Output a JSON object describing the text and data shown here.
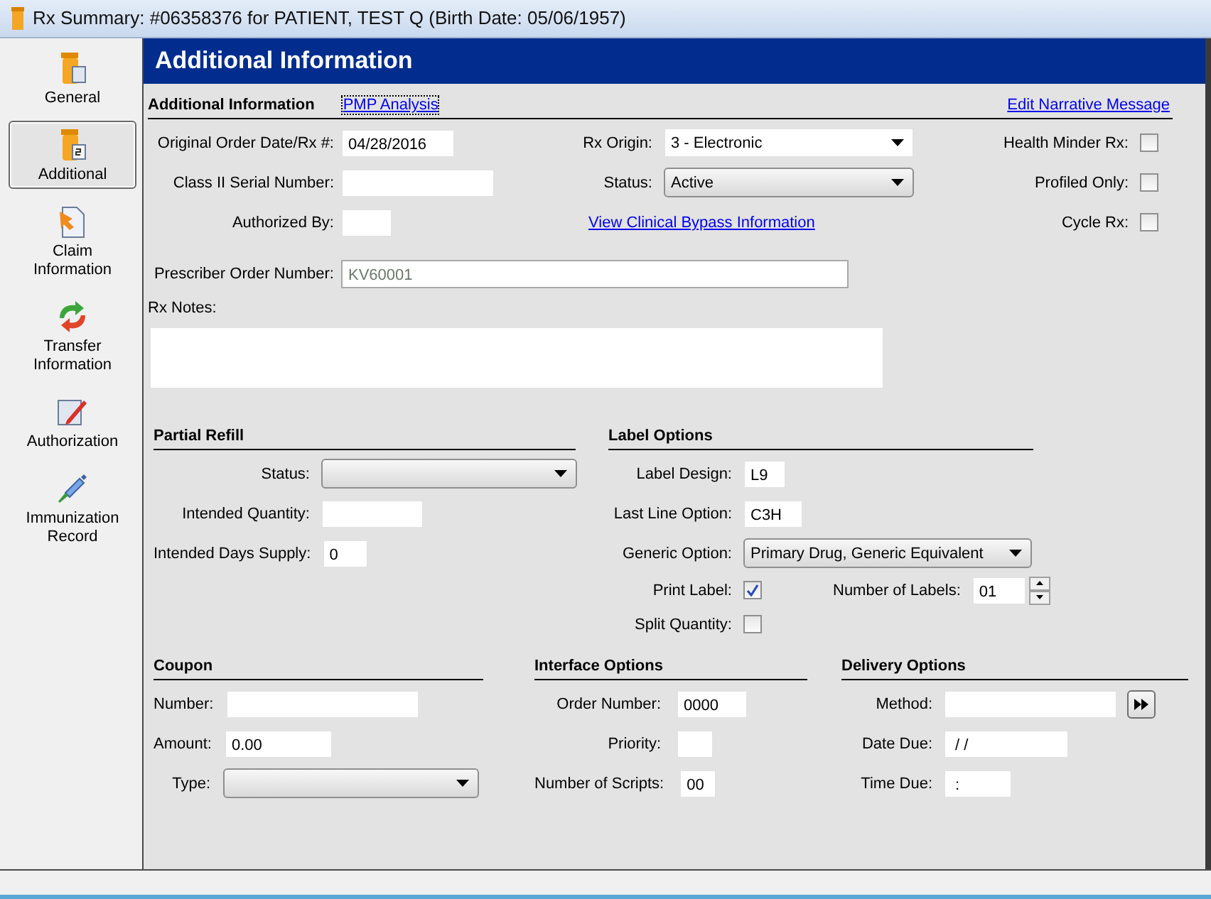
{
  "window": {
    "title": "Rx Summary: #06358376 for PATIENT, TEST Q (Birth Date: 05/06/1957)"
  },
  "sidebar": {
    "items": [
      {
        "label": "General",
        "selected": false
      },
      {
        "label": "Additional",
        "selected": true
      },
      {
        "label": "Claim Information",
        "selected": false
      },
      {
        "label": "Transfer Information",
        "selected": false
      },
      {
        "label": "Authorization",
        "selected": false
      },
      {
        "label": "Immunization Record",
        "selected": false
      }
    ]
  },
  "header": {
    "title": "Additional Information"
  },
  "subheader": {
    "title": "Additional Information",
    "links": [
      {
        "label": "PMP Analysis",
        "focused": true
      },
      {
        "label": "Edit Narrative Message",
        "focused": false
      }
    ]
  },
  "order_info": {
    "columns": [
      {
        "fields": [
          {
            "kind": "text",
            "label": "Original Order Date/Rx #:",
            "value": "04/28/2016"
          },
          {
            "kind": "text",
            "label": "Class II Serial Number:"
          },
          {
            "kind": "text",
            "label": "Authorized By:"
          }
        ]
      },
      {
        "fields": [
          {
            "kind": "combo",
            "label": "Rx Origin:",
            "value": "3 - Electronic"
          },
          {
            "kind": "select",
            "label": "Status:",
            "value": "Active"
          },
          {
            "kind": "link",
            "label": "View Clinical Bypass Information"
          }
        ]
      },
      {
        "fields": [
          {
            "kind": "checkbox",
            "label": "Health Minder Rx:",
            "checked": false
          },
          {
            "kind": "checkbox",
            "label": "Profiled Only:",
            "checked": false
          },
          {
            "kind": "checkbox",
            "label": "Cycle Rx:",
            "checked": false
          }
        ]
      }
    ]
  },
  "order_details": {
    "fields": [
      {
        "kind": "readonly",
        "label": "Prescriber Order Number:",
        "value": "KV60001"
      },
      {
        "kind": "textarea",
        "label": "Rx Notes:"
      }
    ]
  },
  "partial_refill": {
    "title": "Partial Refill",
    "rows": [
      [
        {
          "kind": "select",
          "label": "Status:"
        }
      ],
      [
        {
          "kind": "text",
          "label": "Intended Quantity:"
        }
      ],
      [
        {
          "kind": "text",
          "label": "Intended Days Supply:",
          "value": "0"
        }
      ]
    ]
  },
  "label_options": {
    "title": "Label Options",
    "rows": [
      [
        {
          "kind": "text",
          "label": "Label Design:",
          "value": "L9"
        }
      ],
      [
        {
          "kind": "text",
          "label": "Last Line Option:",
          "value": "C3H"
        }
      ],
      [
        {
          "kind": "select",
          "label": "Generic Option:",
          "value": "Primary Drug, Generic Equivalent"
        }
      ],
      [
        {
          "kind": "checkbox",
          "label": "Print Label:",
          "checked": true
        },
        {
          "kind": "spinner",
          "label": "Number of Labels:",
          "value": "01"
        }
      ],
      [
        {
          "kind": "checkbox",
          "label": "Split Quantity:",
          "checked": false
        }
      ]
    ]
  },
  "coupon": {
    "title": "Coupon",
    "rows": [
      [
        {
          "kind": "text",
          "label": "Number:"
        }
      ],
      [
        {
          "kind": "text",
          "label": "Amount:",
          "value": "0.00"
        }
      ],
      [
        {
          "kind": "select",
          "label": "Type:"
        }
      ]
    ]
  },
  "interface_options": {
    "title": "Interface Options",
    "rows": [
      [
        {
          "kind": "text",
          "label": "Order Number:",
          "value": "0000"
        }
      ],
      [
        {
          "kind": "text",
          "label": "Priority:"
        }
      ],
      [
        {
          "kind": "text",
          "label": "Number of Scripts:",
          "value": "00"
        }
      ]
    ]
  },
  "delivery_options": {
    "title": "Delivery Options",
    "rows": [
      [
        {
          "kind": "text",
          "label": "Method:"
        },
        {
          "kind": "button"
        }
      ],
      [
        {
          "kind": "text",
          "label": "Date Due:",
          "value": " / /"
        }
      ],
      [
        {
          "kind": "text",
          "label": "Time Due:",
          "value": " :"
        }
      ]
    ]
  }
}
